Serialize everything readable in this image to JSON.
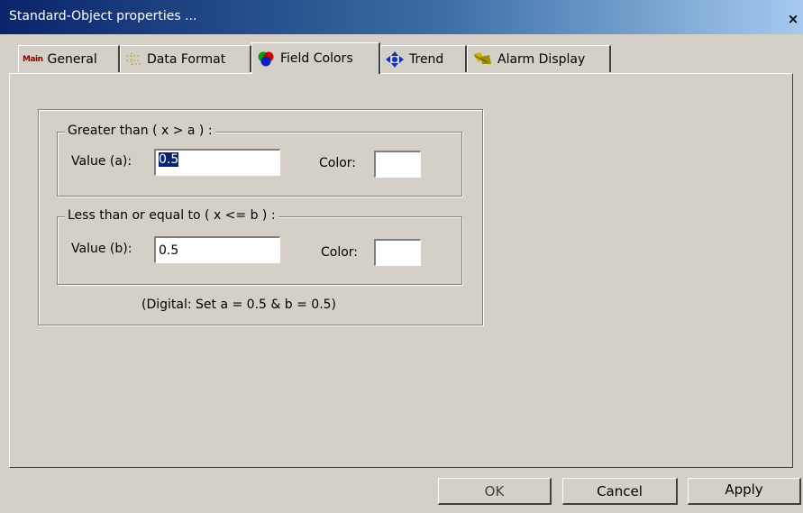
{
  "window": {
    "title": "Standard-Object properties ...",
    "close_glyph": "×"
  },
  "tabs": [
    {
      "label": "General",
      "icon": "main-icon",
      "icon_text": "Main"
    },
    {
      "label": "Data Format",
      "icon": "data-format-icon"
    },
    {
      "label": "Field Colors",
      "icon": "field-colors-icon",
      "active": true
    },
    {
      "label": "Trend",
      "icon": "trend-icon"
    },
    {
      "label": "Alarm Display",
      "icon": "alarm-display-icon"
    }
  ],
  "greater": {
    "legend": "Greater than ( x > a ) :",
    "value_label": "Value (a):",
    "value": "0.5",
    "color_label": "Color:",
    "color": "#ffffff"
  },
  "less": {
    "legend": "Less than or equal to ( x <= b ) :",
    "value_label": "Value (b):",
    "value": "0.5",
    "color_label": "Color:",
    "color": "#ffffff"
  },
  "note": "(Digital: Set a = 0.5  &  b = 0.5)",
  "buttons": {
    "ok": "OK",
    "cancel": "Cancel",
    "apply": "Apply"
  },
  "colors": {
    "titlebar_start": "#0a246a",
    "face": "#d4d0c8",
    "selection": "#0a246a"
  }
}
